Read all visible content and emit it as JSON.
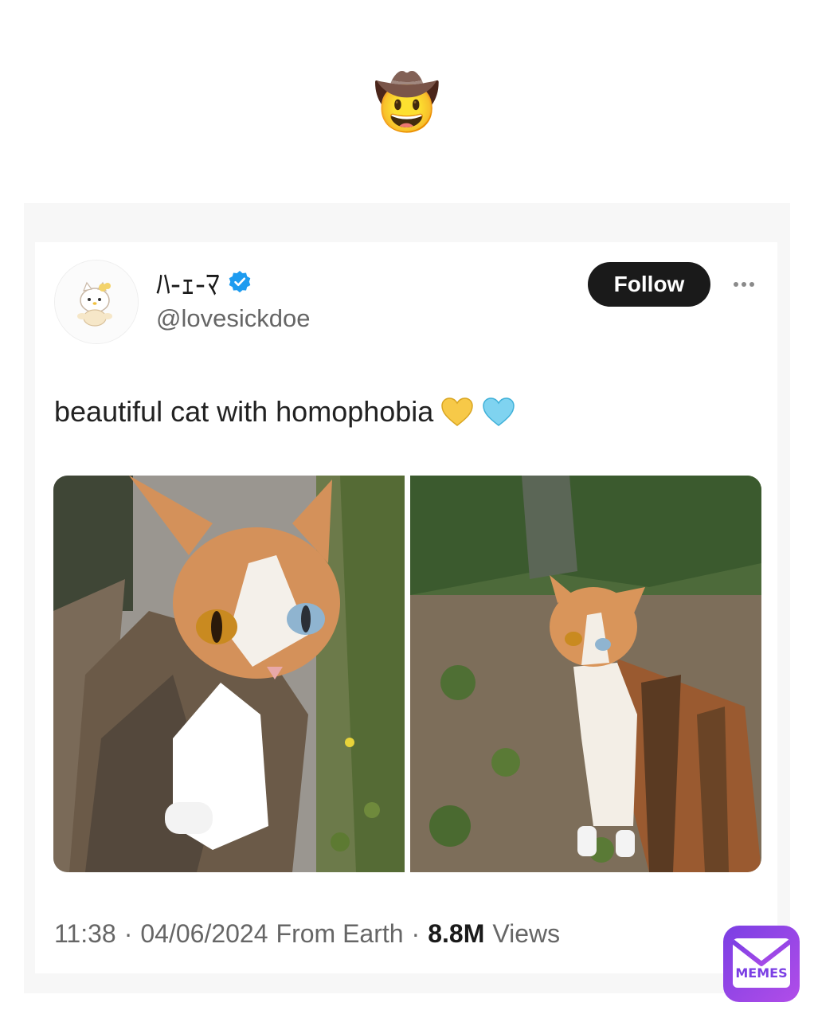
{
  "header": {
    "emoji": "🤠",
    "emoji_name": "cowboy-hat-face"
  },
  "tweet": {
    "display_name": "ﾊ-ｪ-ﾏ",
    "verified": true,
    "handle": "@lovesickdoe",
    "follow_label": "Follow",
    "text": "beautiful cat with homophobia",
    "text_emoji": [
      "yellow-heart",
      "light-blue-heart"
    ],
    "images": [
      {
        "name": "cat-closeup-photo",
        "description_icon": "calico-cat-heterochromia"
      },
      {
        "name": "cat-garden-photo",
        "description_icon": "calico-cat-standing"
      }
    ],
    "meta": {
      "time": "11:38",
      "separator": "·",
      "date": "04/06/2024",
      "location": "From Earth",
      "views_count": "8.8M",
      "views_label": "Views"
    }
  },
  "watermark": {
    "label": "MEMES"
  },
  "colors": {
    "follow_bg": "#1a1a1a",
    "verified_blue": "#1d9bf0",
    "yellow_heart": "#f7c948",
    "blue_heart": "#7fd3f0",
    "watermark_gradient_start": "#7b3fe4",
    "watermark_gradient_end": "#b14de8"
  }
}
